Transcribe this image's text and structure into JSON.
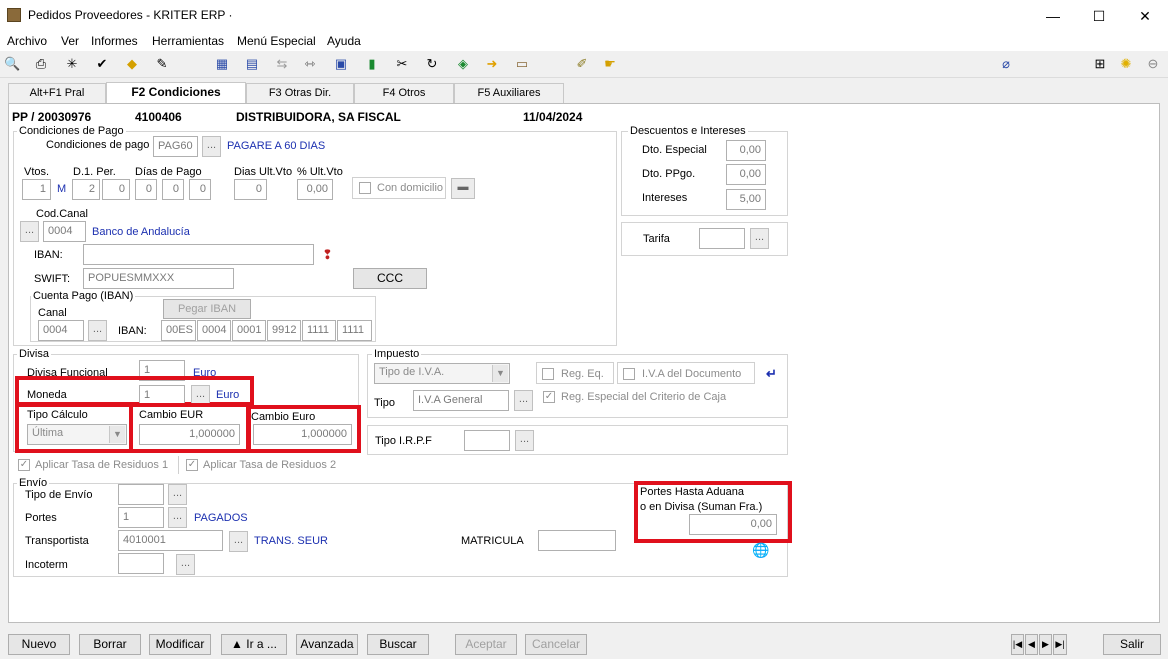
{
  "window": {
    "title": "Pedidos Proveedores - KRITER ERP ·",
    "minimize": "—",
    "maximize": "☐",
    "close": "✕"
  },
  "menu": [
    "Archivo",
    "Ver",
    "Informes",
    "Herramientas",
    "Menú Especial",
    "Ayuda"
  ],
  "tabs": [
    "Alt+F1 Pral",
    "F2 Condiciones",
    "F3 Otras Dir.",
    "F4 Otros",
    "F5 Auxiliares"
  ],
  "header": {
    "doc": "PP / 20030976",
    "code": "4100406",
    "supplier": "DISTRIBUIDORA, SA FISCAL",
    "date": "11/04/2024"
  },
  "pago": {
    "legend": "Condiciones de Pago",
    "cond_label": "Condiciones de pago",
    "cond_code": "PAG60",
    "cond_desc": "PAGARE A 60 DIAS",
    "vtos_label": "Vtos.",
    "d1_label": "D.1. Per.",
    "dias_label": "Días de Pago",
    "dias_ult_label": "Dias Ult.Vto",
    "pct_ult_label": "% Ult.Vto",
    "vtos": "1",
    "vtos_unit": "M",
    "d1a": "2",
    "d1b": "0",
    "dias": [
      "0",
      "0",
      "0"
    ],
    "dias_ult": "0",
    "pct_ult": "0,00",
    "con_domicilio": "Con domicilio",
    "cod_canal_label": "Cod.Canal",
    "cod_canal": "0004",
    "banco": "Banco de Andalucía",
    "iban_label": "IBAN:",
    "iban": "",
    "swift_label": "SWIFT:",
    "swift": "POPUESMMXXX",
    "ccc_button": "CCC",
    "cuenta_legend": "Cuenta Pago (IBAN)",
    "canal_label": "Canal",
    "canal": "0004",
    "pegar_iban": "Pegar IBAN",
    "iban2_label": "IBAN:",
    "iban_parts": [
      "00ES",
      "0004",
      "0001",
      "9912",
      "1111",
      "1111"
    ]
  },
  "descuentos": {
    "legend": "Descuentos e Intereses",
    "especial_label": "Dto. Especial",
    "especial": "0,00",
    "ppgo_label": "Dto. PPgo.",
    "ppgo": "0,00",
    "intereses_label": "Intereses",
    "intereses": "5,00",
    "tarifa_label": "Tarifa",
    "tarifa": ""
  },
  "divisa": {
    "legend": "Divisa",
    "funcional_label": "Divisa Funcional",
    "funcional": "1",
    "funcional_name": "Euro",
    "moneda_label": "Moneda",
    "moneda": "1",
    "moneda_name": "Euro",
    "tipo_calculo_label": "Tipo Cálculo",
    "tipo_calculo": "Última",
    "cambio_eur_label": "Cambio EUR",
    "cambio_eur": "1,000000",
    "cambio_euro_label": "Cambio Euro",
    "cambio_euro": "1,000000",
    "residuos1": "Aplicar Tasa de Residuos 1",
    "residuos2": "Aplicar Tasa de Residuos 2"
  },
  "impuesto": {
    "legend": "Impuesto",
    "tipo_iva": "Tipo de I.V.A.",
    "reg_eq": "Reg. Eq.",
    "iva_doc": "I.V.A del Documento",
    "tipo_label": "Tipo",
    "tipo": "I.V.A General",
    "criterio_caja": "Reg. Especial del Criterio de Caja",
    "irpf_label": "Tipo I.R.P.F",
    "irpf": ""
  },
  "envio": {
    "legend": "Envío",
    "tipo_label": "Tipo de Envío",
    "tipo": "",
    "portes_label": "Portes",
    "portes": "1",
    "portes_name": "PAGADOS",
    "transportista_label": "Transportista",
    "transportista": "4010001",
    "transportista_name": "TRANS. SEUR",
    "incoterm_label": "Incoterm",
    "incoterm": "",
    "matricula_label": "MATRICULA",
    "matricula": "",
    "portes_aduana_label1": "Portes Hasta Aduana",
    "portes_aduana_label2": "o en Divisa (Suman Fra.)",
    "portes_aduana": "0,00"
  },
  "buttons": {
    "nuevo": "Nuevo",
    "borrar": "Borrar",
    "modificar": "Modificar",
    "ira": "▲ Ir a ...",
    "avanzada": "Avanzada",
    "buscar": "Buscar",
    "aceptar": "Aceptar",
    "cancelar": "Cancelar",
    "salir": "Salir"
  },
  "nav": [
    "|◀",
    "◀",
    "▶",
    "▶|"
  ]
}
